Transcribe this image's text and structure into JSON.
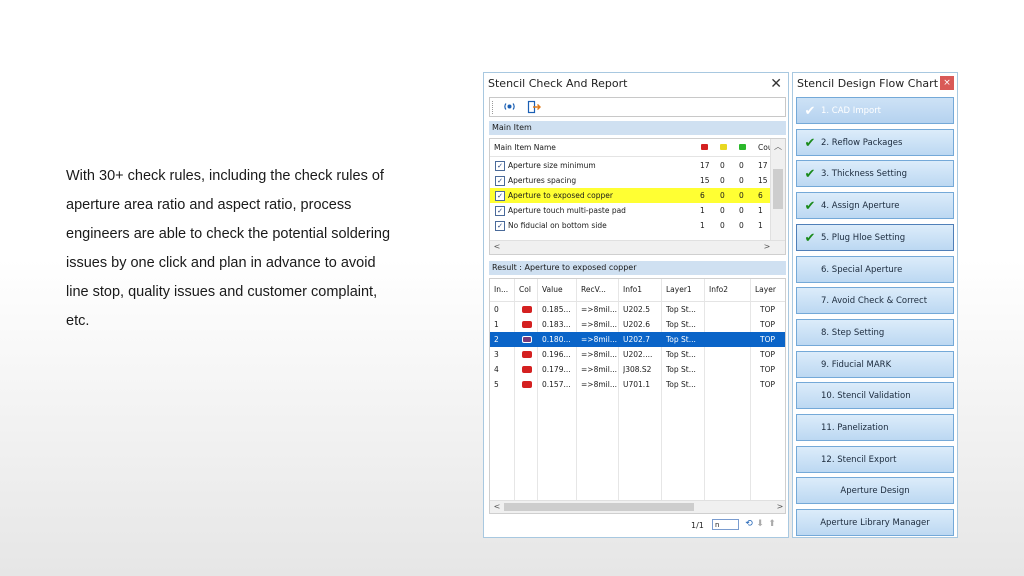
{
  "description": {
    "lines": [
      "With 30+ check rules, including the check rules of",
      "aperture area ratio and aspect ratio, process",
      "engineers are able to check the potential soldering",
      "issues by one click and plan in advance to avoid",
      "line stop, quality issues and customer complaint,",
      "etc."
    ]
  },
  "report_window": {
    "title": "Stencil Check And Report",
    "close_glyph": "✕",
    "toolbar": {
      "run_icon": "check-run-icon",
      "exit_icon": "exit-icon"
    },
    "main_section_label": "Main Item",
    "main_headers": {
      "name": "Main Item Name",
      "count": "Cou"
    },
    "status_colors": {
      "red": "#d42020",
      "yellow": "#e8d820",
      "green": "#2ab82a"
    },
    "main_rows": [
      {
        "name": "Aperture size minimum",
        "red": "17",
        "yellow": "0",
        "green": "0",
        "count": "17",
        "checked": "✓",
        "highlight": false
      },
      {
        "name": "Apertures spacing",
        "red": "15",
        "yellow": "0",
        "green": "0",
        "count": "15",
        "checked": "✓",
        "highlight": false
      },
      {
        "name": "Aperture to exposed copper",
        "red": "6",
        "yellow": "0",
        "green": "0",
        "count": "6",
        "checked": "✓",
        "highlight": true
      },
      {
        "name": "Aperture touch multi-paste pad",
        "red": "1",
        "yellow": "0",
        "green": "0",
        "count": "1",
        "checked": "✓",
        "highlight": false
      },
      {
        "name": "No fiducial on bottom side",
        "red": "1",
        "yellow": "0",
        "green": "0",
        "count": "1",
        "checked": "✓",
        "highlight": false
      }
    ],
    "result_section_label": "Result : Aperture to exposed copper",
    "result_headers": [
      "In...",
      "Col",
      "Value",
      "RecV...",
      "Info1",
      "Layer1",
      "Info2",
      "Layer"
    ],
    "result_rows": [
      {
        "index": "0",
        "color": "#d42020",
        "value": "0.185...",
        "rec": "=>8mil...",
        "info1": "U202.5",
        "layer1": "Top St...",
        "info2": "",
        "layer": "TOP",
        "selected": false
      },
      {
        "index": "1",
        "color": "#d42020",
        "value": "0.183...",
        "rec": "=>8mil...",
        "info1": "U202.6",
        "layer1": "Top St...",
        "info2": "",
        "layer": "TOP",
        "selected": false
      },
      {
        "index": "2",
        "color": "#7a3a78",
        "value": "0.180...",
        "rec": "=>8mil...",
        "info1": "U202.7",
        "layer1": "Top St...",
        "info2": "",
        "layer": "TOP",
        "selected": true
      },
      {
        "index": "3",
        "color": "#d42020",
        "value": "0.196...",
        "rec": "=>8mil...",
        "info1": "U202....",
        "layer1": "Top St...",
        "info2": "",
        "layer": "TOP",
        "selected": false
      },
      {
        "index": "4",
        "color": "#d42020",
        "value": "0.179...",
        "rec": "=>8mil...",
        "info1": "J308.S2",
        "layer1": "Top St...",
        "info2": "",
        "layer": "TOP",
        "selected": false
      },
      {
        "index": "5",
        "color": "#d42020",
        "value": "0.157...",
        "rec": "=>8mil...",
        "info1": "U701.1",
        "layer1": "Top St...",
        "info2": "",
        "layer": "TOP",
        "selected": false
      }
    ],
    "pager": {
      "label": "1/1",
      "input_value": "n",
      "nav": [
        "⟲",
        "⬇",
        "⬆"
      ]
    }
  },
  "flow_window": {
    "title": "Stencil Design Flow Chart",
    "close_glyph": "×",
    "steps": [
      {
        "label": "1. CAD Import",
        "checked": true,
        "disabled": true,
        "active": false,
        "align": "left"
      },
      {
        "label": "2. Reflow Packages",
        "checked": true,
        "disabled": false,
        "active": false,
        "align": "left"
      },
      {
        "label": "3. Thickness Setting",
        "checked": true,
        "disabled": false,
        "active": false,
        "align": "left"
      },
      {
        "label": "4. Assign Aperture",
        "checked": true,
        "disabled": false,
        "active": false,
        "align": "left"
      },
      {
        "label": "5. Plug Hloe Setting",
        "checked": true,
        "disabled": false,
        "active": true,
        "align": "left"
      },
      {
        "label": "6. Special Aperture",
        "checked": false,
        "disabled": false,
        "active": false,
        "align": "left"
      },
      {
        "label": "7. Avoid Check & Correct",
        "checked": false,
        "disabled": false,
        "active": false,
        "align": "left"
      },
      {
        "label": "8. Step Setting",
        "checked": false,
        "disabled": false,
        "active": false,
        "align": "left"
      },
      {
        "label": "9. Fiducial MARK",
        "checked": false,
        "disabled": false,
        "active": false,
        "align": "left"
      },
      {
        "label": "10. Stencil Validation",
        "checked": false,
        "disabled": false,
        "active": false,
        "align": "left"
      },
      {
        "label": "11. Panelization",
        "checked": false,
        "disabled": false,
        "active": false,
        "align": "left"
      },
      {
        "label": "12. Stencil Export",
        "checked": false,
        "disabled": false,
        "active": false,
        "align": "left"
      },
      {
        "label": "Aperture Design",
        "checked": false,
        "disabled": false,
        "active": false,
        "align": "center"
      },
      {
        "label": "Aperture Library Manager",
        "checked": false,
        "disabled": false,
        "active": false,
        "align": "center"
      }
    ]
  }
}
